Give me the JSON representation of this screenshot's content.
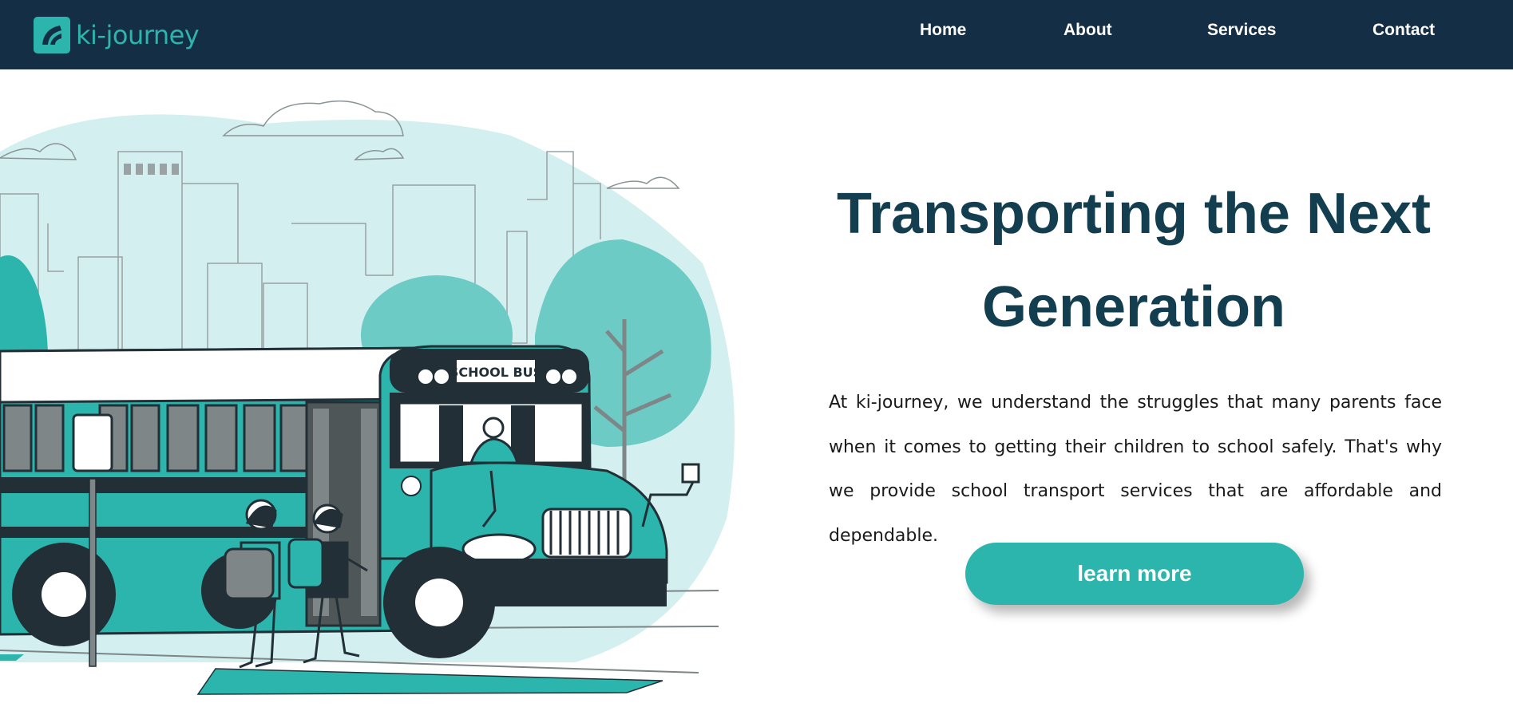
{
  "brand": {
    "name": "ki-journey",
    "logo_icon": "ki-journey-logo-icon",
    "color": "#2bb5ac"
  },
  "nav": {
    "background": "#142f45",
    "links": [
      {
        "label": "Home"
      },
      {
        "label": "About"
      },
      {
        "label": "Services"
      },
      {
        "label": "Contact"
      }
    ]
  },
  "hero": {
    "title_line1": "Transporting the Next",
    "title_line2": "Generation",
    "description": "At ki-journey, we understand the struggles that many parents face when it comes to getting their children to school safely. That's why we provide school transport services that are affordable and dependable.",
    "cta_label": "learn more",
    "illustration": {
      "icon": "school-bus-illustration",
      "bus_sign": "SCHOOL BUS"
    }
  },
  "colors": {
    "title": "#133e50",
    "accent": "#2bb5ac",
    "light_accent": "#d3efef",
    "dark": "#222f36"
  }
}
